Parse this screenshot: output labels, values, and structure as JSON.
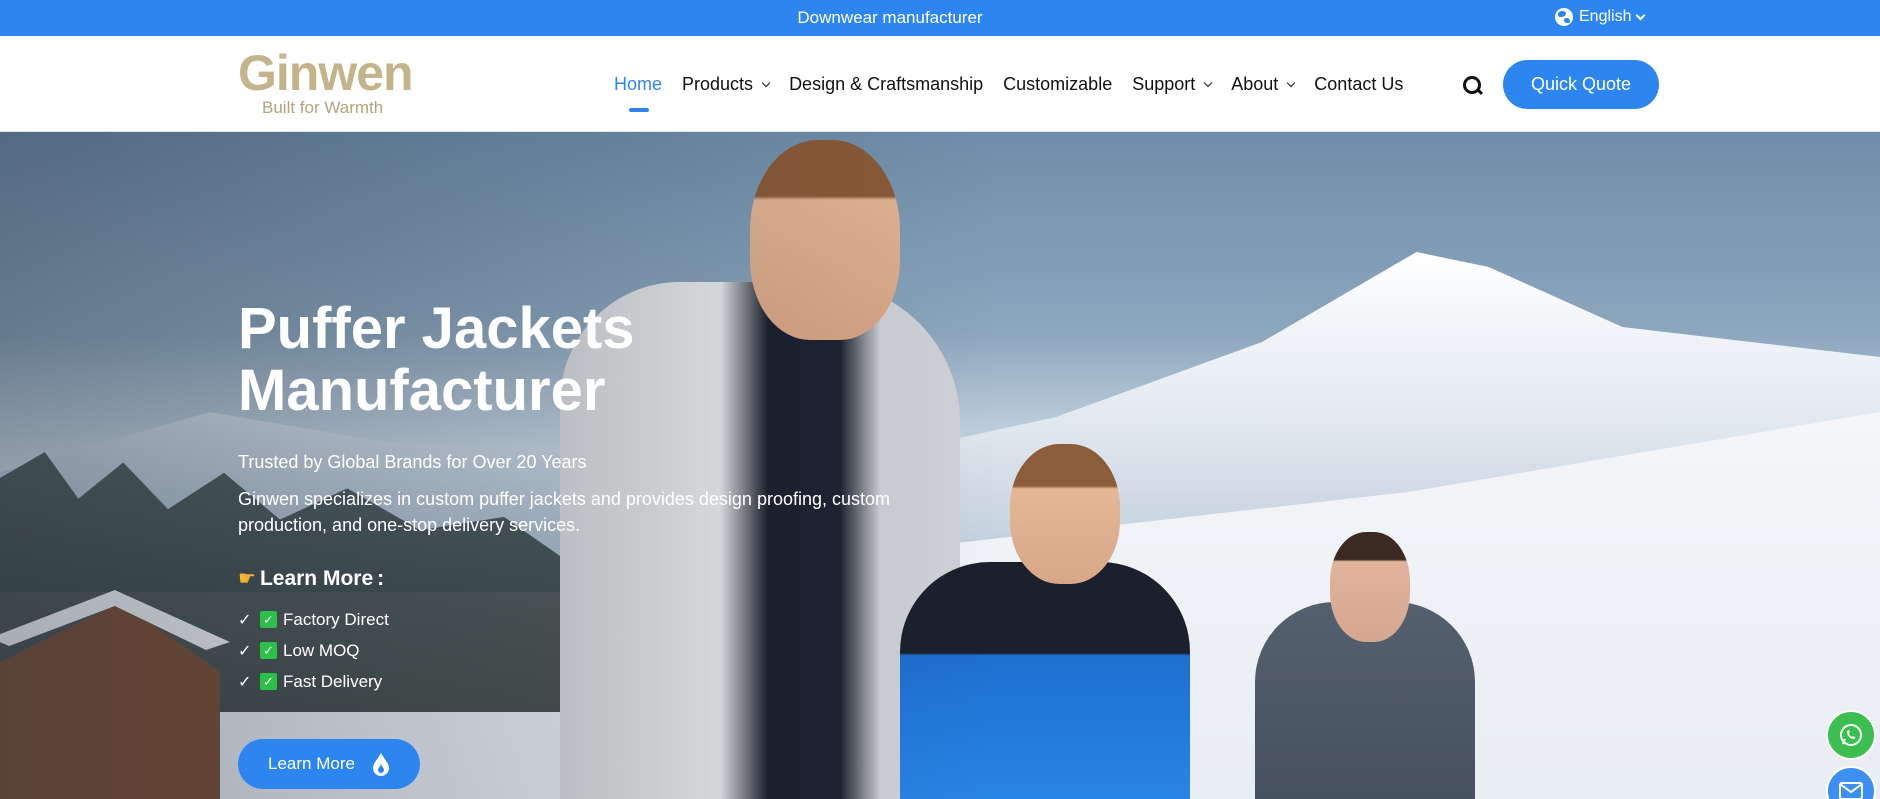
{
  "topbar": {
    "tagline": "Downwear manufacturer",
    "language": "English",
    "background": "#2d86f0"
  },
  "header": {
    "logo_word": "Ginwen",
    "logo_slogan": "Built for Warmth",
    "logo_color": "#c3b48c",
    "nav": [
      {
        "label": "Home",
        "active": true,
        "dropdown": false
      },
      {
        "label": "Products",
        "active": false,
        "dropdown": true
      },
      {
        "label": "Design & Craftsmanship",
        "active": false,
        "dropdown": false
      },
      {
        "label": "Customizable",
        "active": false,
        "dropdown": false
      },
      {
        "label": "Support",
        "active": false,
        "dropdown": true
      },
      {
        "label": "About",
        "active": false,
        "dropdown": true
      },
      {
        "label": "Contact Us",
        "active": false,
        "dropdown": false
      }
    ],
    "search_icon": "search-icon",
    "quote_label": "Quick Quote",
    "accent": "#2d86f0"
  },
  "hero": {
    "title_line1": "Puffer Jackets",
    "title_line2": "Manufacturer",
    "subtitle": "Trusted by Global Brands for Over 20 Years",
    "description": "Ginwen specializes in custom puffer jackets and provides design proofing, custom production, and one-stop delivery services.",
    "learn_heading": "Learn More",
    "learn_colon": ":",
    "features": [
      {
        "check": "✓",
        "box": "✓",
        "label": "Factory Direct"
      },
      {
        "check": "✓",
        "box": "✓",
        "label": "Low MOQ"
      },
      {
        "check": "✓",
        "box": "✓",
        "label": "Fast Delivery"
      }
    ],
    "button_label": "Learn More"
  },
  "floating": {
    "whatsapp_icon": "whatsapp-icon",
    "mail_icon": "mail-icon"
  }
}
